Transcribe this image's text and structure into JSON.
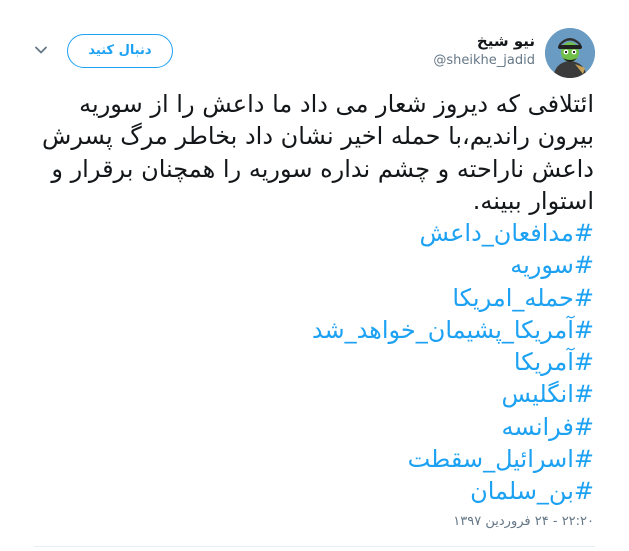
{
  "header": {
    "display_name": "نیو شیخ",
    "handle": "@sheikhe_jadid",
    "follow_label": "دنبال کنید"
  },
  "tweet": {
    "text": "ائتلافی که دیروز شعار می داد ما داعش را از سوریه بیرون راندیم،با حمله اخیر نشان داد بخاطر مرگ پسرش داعش ناراحته و چشم نداره سوریه را همچنان برقرار و استوار ببینه.",
    "hashtags": [
      "#مدافعان_داعش",
      "#سوریه",
      "#حمله_امریکا",
      "#آمریکا_پشیمان_خواهد_شد",
      "#آمریکا",
      "#انگلیس",
      "#فرانسه",
      "#اسرائیل_سقطت",
      "#بن_سلمان"
    ],
    "timestamp": "۲۲:۲۰ - ۲۴ فروردین ۱۳۹۷"
  },
  "colors": {
    "link": "#1da1f2",
    "text": "#14171a",
    "muted": "#657786"
  },
  "icons": {
    "caret": "chevron-down-icon",
    "avatar": "avatar"
  }
}
